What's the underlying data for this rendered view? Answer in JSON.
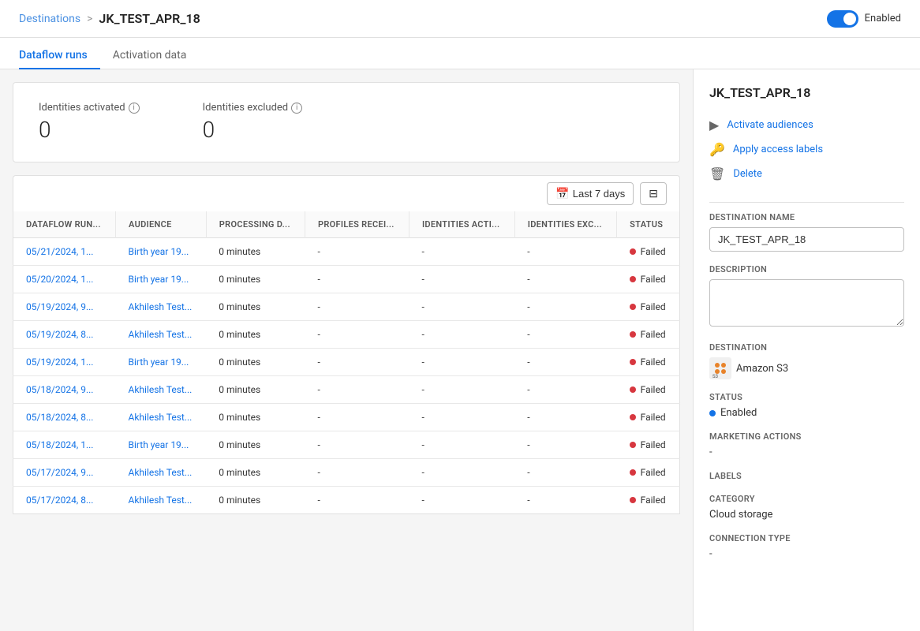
{
  "breadcrumb": {
    "parent": "Destinations",
    "separator": ">",
    "current": "JK_TEST_APR_18"
  },
  "toggle": {
    "enabled": true,
    "label": "Enabled"
  },
  "tabs": [
    {
      "id": "dataflow-runs",
      "label": "Dataflow runs",
      "active": true
    },
    {
      "id": "activation-data",
      "label": "Activation data",
      "active": false
    }
  ],
  "stats": {
    "identities_activated": {
      "label": "Identities activated",
      "value": "0"
    },
    "identities_excluded": {
      "label": "Identities excluded",
      "value": "0"
    }
  },
  "toolbar": {
    "date_range": "Last 7 days",
    "filter_icon": "filter"
  },
  "table": {
    "columns": [
      "DATAFLOW RUN...",
      "AUDIENCE",
      "PROCESSING D...",
      "PROFILES RECEI...",
      "IDENTITIES ACTI...",
      "IDENTITIES EXC...",
      "STATUS"
    ],
    "rows": [
      {
        "run": "05/21/2024, 1...",
        "audience": "Birth year 19...",
        "processing": "0 minutes",
        "profiles": "-",
        "identities_act": "-",
        "identities_exc": "-",
        "status": "Failed"
      },
      {
        "run": "05/20/2024, 1...",
        "audience": "Birth year 19...",
        "processing": "0 minutes",
        "profiles": "-",
        "identities_act": "-",
        "identities_exc": "-",
        "status": "Failed"
      },
      {
        "run": "05/19/2024, 9...",
        "audience": "Akhilesh Test...",
        "processing": "0 minutes",
        "profiles": "-",
        "identities_act": "-",
        "identities_exc": "-",
        "status": "Failed"
      },
      {
        "run": "05/19/2024, 8...",
        "audience": "Akhilesh Test...",
        "processing": "0 minutes",
        "profiles": "-",
        "identities_act": "-",
        "identities_exc": "-",
        "status": "Failed"
      },
      {
        "run": "05/19/2024, 1...",
        "audience": "Birth year 19...",
        "processing": "0 minutes",
        "profiles": "-",
        "identities_act": "-",
        "identities_exc": "-",
        "status": "Failed"
      },
      {
        "run": "05/18/2024, 9...",
        "audience": "Akhilesh Test...",
        "processing": "0 minutes",
        "profiles": "-",
        "identities_act": "-",
        "identities_exc": "-",
        "status": "Failed"
      },
      {
        "run": "05/18/2024, 8...",
        "audience": "Akhilesh Test...",
        "processing": "0 minutes",
        "profiles": "-",
        "identities_act": "-",
        "identities_exc": "-",
        "status": "Failed"
      },
      {
        "run": "05/18/2024, 1...",
        "audience": "Birth year 19...",
        "processing": "0 minutes",
        "profiles": "-",
        "identities_act": "-",
        "identities_exc": "-",
        "status": "Failed"
      },
      {
        "run": "05/17/2024, 9...",
        "audience": "Akhilesh Test...",
        "processing": "0 minutes",
        "profiles": "-",
        "identities_act": "-",
        "identities_exc": "-",
        "status": "Failed"
      },
      {
        "run": "05/17/2024, 8...",
        "audience": "Akhilesh Test...",
        "processing": "0 minutes",
        "profiles": "-",
        "identities_act": "-",
        "identities_exc": "-",
        "status": "Failed"
      }
    ]
  },
  "sidebar": {
    "title": "JK_TEST_APR_18",
    "actions": [
      {
        "id": "activate-audiences",
        "label": "Activate audiences",
        "icon": "▶"
      },
      {
        "id": "apply-access-labels",
        "label": "Apply access labels",
        "icon": "🔑"
      },
      {
        "id": "delete",
        "label": "Delete",
        "icon": "🗑"
      }
    ],
    "destination_name": {
      "label": "Destination name",
      "value": "JK_TEST_APR_18"
    },
    "description": {
      "label": "Description",
      "value": ""
    },
    "destination": {
      "label": "Destination",
      "value": "Amazon S3"
    },
    "status": {
      "label": "Status",
      "value": "Enabled"
    },
    "marketing_actions": {
      "label": "Marketing actions",
      "value": "-"
    },
    "labels": {
      "label": "Labels",
      "value": ""
    },
    "category": {
      "label": "Category",
      "value": "Cloud storage"
    },
    "connection_type": {
      "label": "Connection type",
      "value": "-"
    }
  }
}
